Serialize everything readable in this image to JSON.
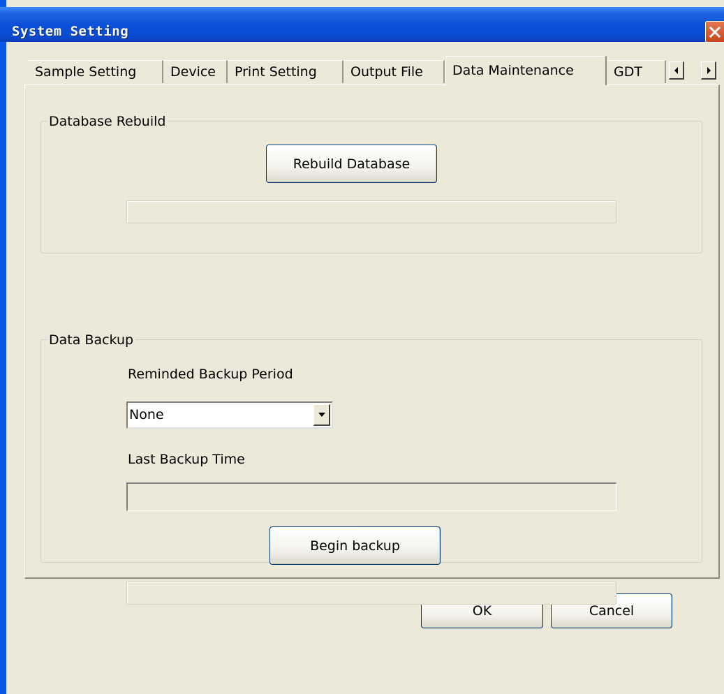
{
  "window": {
    "title": "System Setting"
  },
  "tabs": [
    {
      "label": "Sample Setting",
      "active": false
    },
    {
      "label": "Device",
      "active": false
    },
    {
      "label": "Print Setting",
      "active": false
    },
    {
      "label": "Output File",
      "active": false
    },
    {
      "label": "Data Maintenance",
      "active": true
    },
    {
      "label": "GDT",
      "active": false
    }
  ],
  "database_rebuild": {
    "group_title": "Database Rebuild",
    "rebuild_button": "Rebuild Database",
    "progress": 0
  },
  "data_backup": {
    "group_title": "Data Backup",
    "period_label": "Reminded Backup Period",
    "period_value": "None",
    "last_backup_label": "Last Backup Time",
    "last_backup_value": "",
    "begin_button": "Begin backup",
    "progress": 0
  },
  "footer": {
    "ok_label": "OK",
    "cancel_label": "Cancel"
  },
  "icons": {
    "close": "close-icon",
    "tab_left": "arrow-left-icon",
    "tab_right": "arrow-right-icon",
    "dropdown": "chevron-down-icon"
  },
  "colors": {
    "face": "#ECE9D8",
    "title_bar": "#0A4FD8",
    "close": "#D7502B",
    "button_border": "#003C74"
  }
}
